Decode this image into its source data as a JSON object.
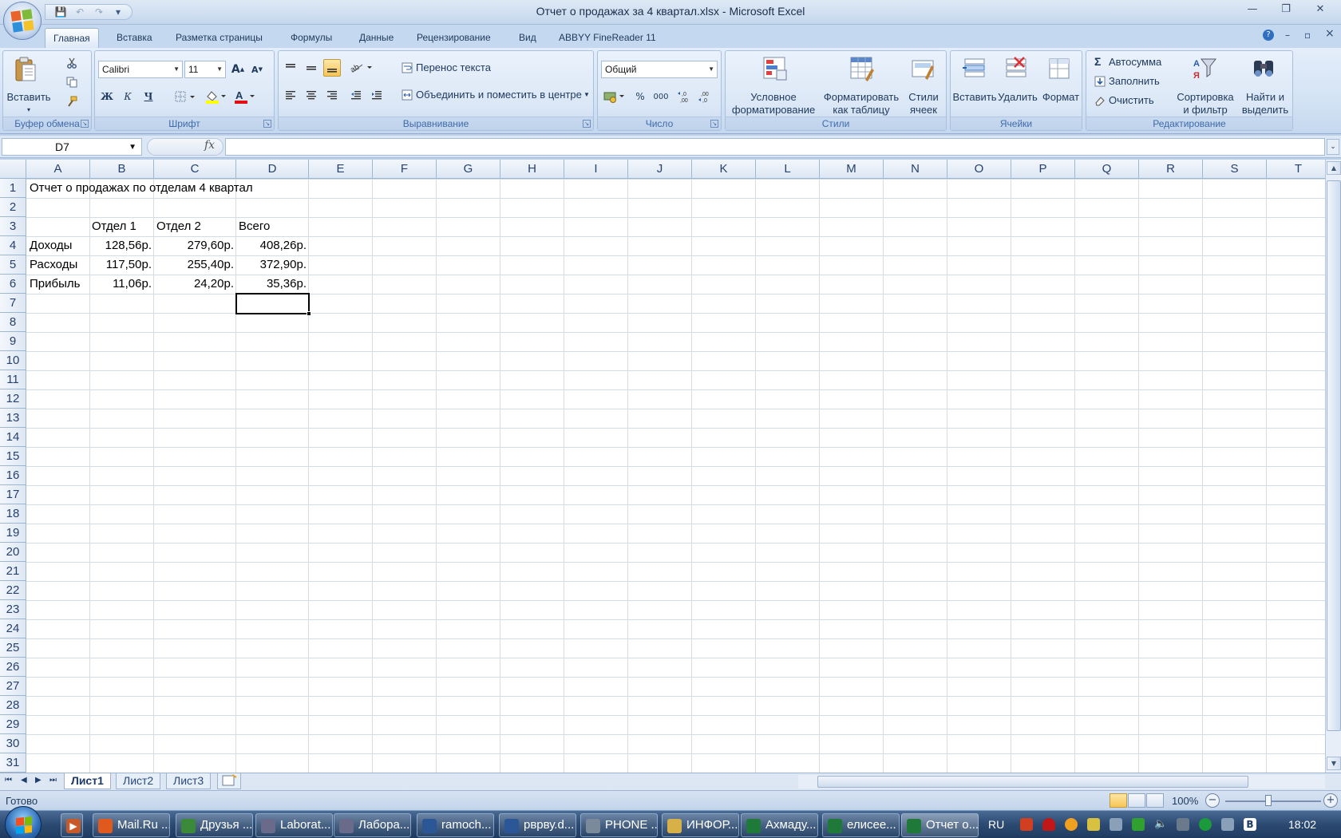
{
  "window": {
    "title": "Отчет о продажах за 4 квартал.xlsx - Microsoft Excel",
    "minimize": "—",
    "restore": "❐",
    "close": "✕"
  },
  "qat": {
    "save": "💾",
    "undo": "↶",
    "redo": "↷",
    "more": "▾"
  },
  "ribbon_tabs": [
    {
      "label": "Главная",
      "active": true
    },
    {
      "label": "Вставка"
    },
    {
      "label": "Разметка страницы"
    },
    {
      "label": "Формулы"
    },
    {
      "label": "Данные"
    },
    {
      "label": "Рецензирование"
    },
    {
      "label": "Вид"
    },
    {
      "label": "ABBYY FineReader 11"
    }
  ],
  "ribbon_right": {
    "help": "?",
    "min": "–",
    "restore": "▫",
    "close": "×"
  },
  "clipboard": {
    "paste": "Вставить",
    "paste_arrow": "▾",
    "group": "Буфер обмена"
  },
  "font": {
    "name": "Calibri",
    "size": "11",
    "bold": "Ж",
    "italic": "К",
    "underline": "Ч",
    "grow": "A",
    "shrink": "A",
    "group": "Шрифт"
  },
  "alignment": {
    "wrap": "Перенос текста",
    "merge": "Объединить и поместить в центре",
    "group": "Выравнивание"
  },
  "number": {
    "format": "Общий",
    "percent": "%",
    "thousands": "000",
    "group": "Число"
  },
  "styles": {
    "conditional_l1": "Условное",
    "conditional_l2": "форматирование",
    "table_l1": "Форматировать",
    "table_l2": "как таблицу",
    "cell_l1": "Стили",
    "cell_l2": "ячеек",
    "group": "Стили"
  },
  "cells_group": {
    "insert": "Вставить",
    "delete": "Удалить",
    "format": "Формат",
    "group": "Ячейки"
  },
  "editing": {
    "autosum": "Автосумма",
    "fill": "Заполнить",
    "clear": "Очистить",
    "sort_l1": "Сортировка",
    "sort_l2": "и фильтр",
    "find_l1": "Найти и",
    "find_l2": "выделить",
    "group": "Редактирование"
  },
  "formula_bar": {
    "name_box": "D7",
    "fx": "fx",
    "value": ""
  },
  "columns": [
    "A",
    "B",
    "C",
    "D",
    "E",
    "F",
    "G",
    "H",
    "I",
    "J",
    "K",
    "L",
    "M",
    "N",
    "O",
    "P",
    "Q",
    "R",
    "S",
    "T"
  ],
  "rows": [
    "1",
    "2",
    "3",
    "4",
    "5",
    "6",
    "7",
    "8",
    "9",
    "10",
    "11",
    "12",
    "13",
    "14",
    "15",
    "16",
    "17",
    "18",
    "19",
    "20",
    "21",
    "22",
    "23",
    "24",
    "25",
    "26",
    "27",
    "28",
    "29",
    "30",
    "31"
  ],
  "sheet": {
    "title": "Отчет о продажах по отделам 4 квартал",
    "headers": [
      "Отдел 1",
      "Отдел 2",
      "Всего"
    ],
    "data_rows": [
      {
        "label": "Доходы",
        "values": [
          "128,56р.",
          "279,60р.",
          "408,26р."
        ]
      },
      {
        "label": "Расходы",
        "values": [
          "117,50р.",
          "255,40р.",
          "372,90р."
        ]
      },
      {
        "label": "Прибыль",
        "values": [
          "11,06р.",
          "24,20р.",
          "35,36р."
        ]
      }
    ]
  },
  "sheet_tabs": [
    "Лист1",
    "Лист2",
    "Лист3"
  ],
  "status": {
    "ready": "Готово",
    "zoom": "100%"
  },
  "taskbar": {
    "items": [
      {
        "label": "Mail.Ru ...",
        "color": "#e05a1e"
      },
      {
        "label": "Друзья ...",
        "color": "#3a8a3a"
      },
      {
        "label": "Laborat...",
        "color": "#6a6a8a"
      },
      {
        "label": "Лабора...",
        "color": "#6a6a8a"
      },
      {
        "label": "ramoch...",
        "color": "#2b5797"
      },
      {
        "label": "рврву.d...",
        "color": "#2b5797"
      },
      {
        "label": "PHONE ...",
        "color": "#7a8a9a"
      },
      {
        "label": "ИНФОР...",
        "color": "#d8b04a"
      },
      {
        "label": "Ахмаду...",
        "color": "#1f7a3a"
      },
      {
        "label": "елисее...",
        "color": "#1f7a3a"
      },
      {
        "label": "Отчет о...",
        "color": "#1f7a3a",
        "active": true
      }
    ],
    "lang": "RU",
    "clock": "18:02"
  }
}
